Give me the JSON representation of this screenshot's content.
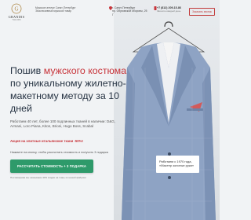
{
  "header": {
    "logo_name": "GRANDIS",
    "logo_sub": "TAILORS",
    "tagline_lines": [
      "Мужское ателье Санкт-Петербург",
      "Эксклюзивный мужской товар"
    ],
    "address_lines": [
      "г. Санкт-Петербург",
      "пр. Обуховской обороны, 25 Г"
    ],
    "phone": "+7 (812) 209-15-86",
    "phone_sub": "Звоните каждый день",
    "callback_label": "Заказать звонок"
  },
  "hero": {
    "title_part1": "Пошив ",
    "title_accent": "мужского костюма",
    "title_part2": " по уникальному жилетно-макетному методу за 10 дней",
    "description": "Работаем 40 лет, более 100 подлинных тканей в наличии: D&G, Armani, Loro Piana, Kiton, Brioni, Hugo Boss, Scabal",
    "promo": "Акция на элитные итальянские ткани -50%!",
    "hint": "Нажмите на кнопку, чтобы рассчитать стоимость и получить 3 подарка",
    "cta_label": "РАССЧИТАТЬ СТОИМОСТЬ + 3 ПОДАРКА",
    "note": "Поставщикам мы оказываем 40% скидки на ткань из нашей фабрики"
  },
  "badge": {
    "lines": [
      "Работаем с 1970 года,",
      "«Мастер золотые руки»"
    ]
  },
  "colors": {
    "accent": "#c8353b",
    "cta": "#2e9a6a",
    "heading": "#263343"
  },
  "icons": [
    "grandis-logo-icon",
    "location-pin-icon",
    "phone-icon"
  ]
}
